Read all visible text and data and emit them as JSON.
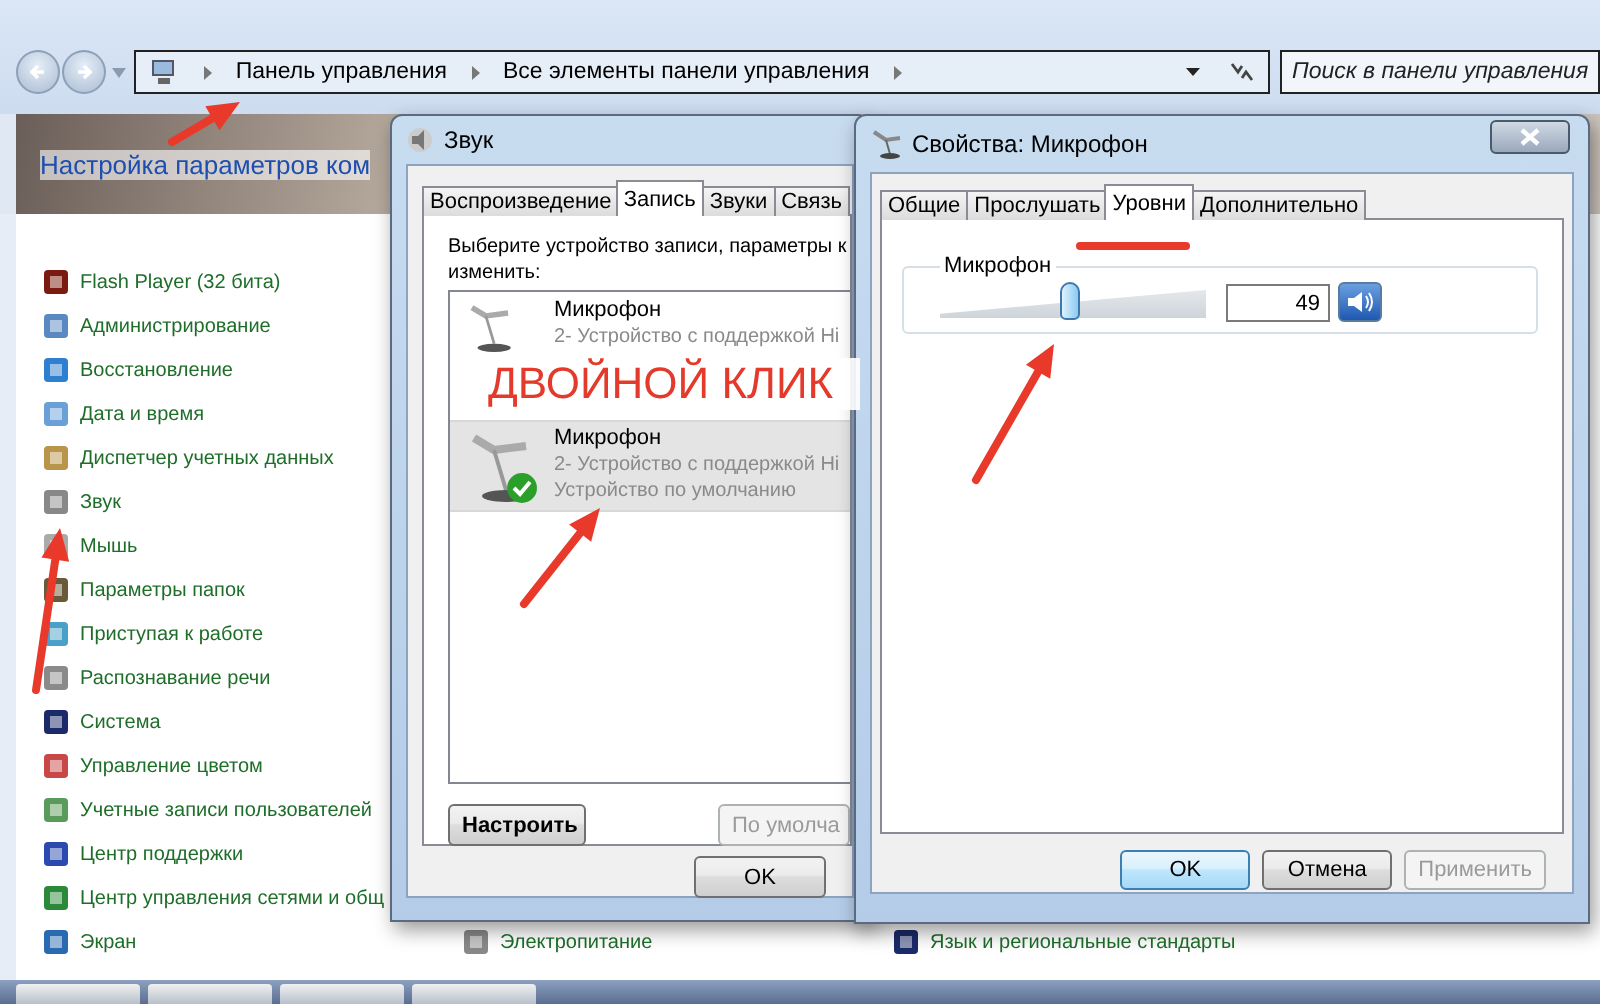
{
  "explorer": {
    "breadcrumbs": [
      "Панель управления",
      "Все элементы панели управления"
    ],
    "search": {
      "placeholder": "Поиск в панели управления"
    },
    "heading": "Настройка параметров ком",
    "columns": [
      [
        "Flash Player (32 бита)",
        "Администрирование",
        "Восстановление",
        "Дата и время",
        "Диспетчер учетных данных",
        "Звук",
        "Мышь",
        "Параметры папок",
        "Приступая к работе",
        "Распознавание речи",
        "Система",
        "Управление цветом",
        "Учетные записи пользователей",
        "Центр поддержки",
        "Центр управления сетями и общ",
        "Экран"
      ],
      [
        "Электропитание"
      ],
      [
        "Язык и региональные стандарты"
      ]
    ]
  },
  "sound_dialog": {
    "title": "Звук",
    "tabs": [
      {
        "label": "Воспроизведение",
        "selected": false
      },
      {
        "label": "Запись",
        "selected": true
      },
      {
        "label": "Звуки",
        "selected": false
      },
      {
        "label": "Связь",
        "selected": false
      }
    ],
    "instruction_lines": [
      "Выберите устройство записи, параметры к",
      "изменить:"
    ],
    "devices": [
      {
        "name": "Микрофон",
        "lines": [
          "2- Устройство с поддержкой Hi"
        ],
        "selected": false,
        "default": false
      },
      {
        "name": "Микрофон",
        "lines": [
          "2- Устройство с поддержкой Hi",
          "Устройство по умолчанию"
        ],
        "selected": true,
        "default": true
      }
    ],
    "buttons": [
      {
        "label": "Настроить",
        "disabled": false
      },
      {
        "label": "По умолча",
        "disabled": true
      }
    ],
    "footer_buttons": [
      {
        "label": "OK",
        "disabled": false
      }
    ]
  },
  "properties_dialog": {
    "title": "Свойства: Микрофон",
    "tabs": [
      {
        "label": "Общие",
        "selected": false
      },
      {
        "label": "Прослушать",
        "selected": false
      },
      {
        "label": "Уровни",
        "selected": true
      },
      {
        "label": "Дополнительно",
        "selected": false
      }
    ],
    "levels": {
      "label": "Микрофон",
      "level": 0.49,
      "value": "49"
    },
    "buttons": [
      {
        "label": "OK",
        "default": true,
        "disabled": false
      },
      {
        "label": "Отмена",
        "default": false,
        "disabled": false
      },
      {
        "label": "Применить",
        "default": false,
        "disabled": true
      }
    ]
  },
  "annotation": {
    "label": "ДВОЙНОЙ КЛИК"
  }
}
